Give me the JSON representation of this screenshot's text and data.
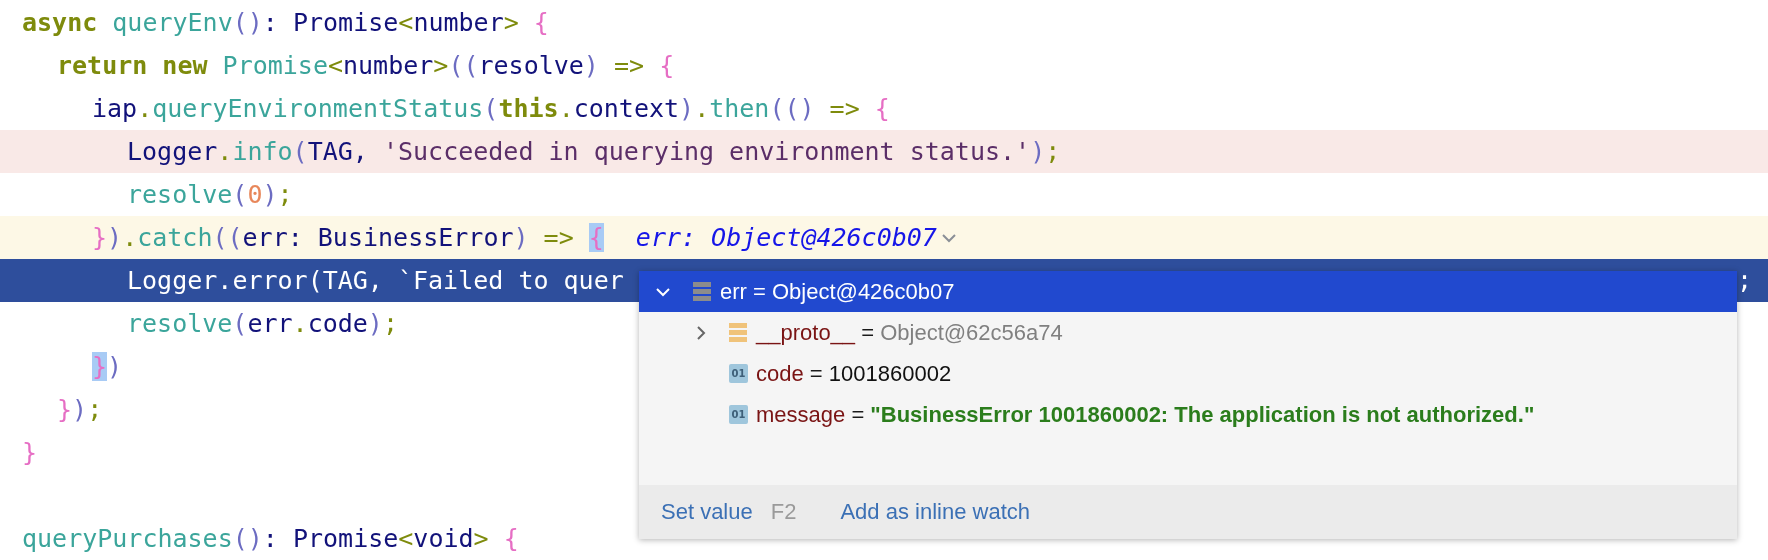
{
  "editor": {
    "lines": [
      {
        "kind": "normal",
        "tokens": [
          {
            "kind": "keyword",
            "text": "async "
          },
          {
            "kind": "fn",
            "text": "queryEnv"
          },
          {
            "kind": "paren",
            "text": "()"
          },
          {
            "kind": "plain",
            "text": ": "
          },
          {
            "kind": "type",
            "text": "Promise"
          },
          {
            "kind": "punct",
            "text": "<"
          },
          {
            "kind": "type",
            "text": "number"
          },
          {
            "kind": "punct",
            "text": ">"
          },
          {
            "kind": "brace",
            "text": " {"
          }
        ],
        "children": [
          {
            "kind": "normal",
            "tokens": [
              {
                "kind": "keyword",
                "text": "return new "
              },
              {
                "kind": "fn",
                "text": "Promise"
              },
              {
                "kind": "punct",
                "text": "<"
              },
              {
                "kind": "type",
                "text": "number"
              },
              {
                "kind": "punct",
                "text": ">"
              },
              {
                "kind": "paren",
                "text": "(("
              },
              {
                "kind": "type",
                "text": "resolve"
              },
              {
                "kind": "paren",
                "text": ")"
              },
              {
                "kind": "punct",
                "text": " => "
              },
              {
                "kind": "brace",
                "text": "{"
              }
            ],
            "children": [
              {
                "kind": "normal",
                "tokens": [
                  {
                    "kind": "type",
                    "text": "iap"
                  },
                  {
                    "kind": "punct",
                    "text": "."
                  },
                  {
                    "kind": "fn",
                    "text": "queryEnvironmentStatus"
                  },
                  {
                    "kind": "paren",
                    "text": "("
                  },
                  {
                    "kind": "keyword",
                    "text": "this"
                  },
                  {
                    "kind": "punct",
                    "text": "."
                  },
                  {
                    "kind": "type",
                    "text": "context"
                  },
                  {
                    "kind": "paren",
                    "text": ")"
                  },
                  {
                    "kind": "punct",
                    "text": "."
                  },
                  {
                    "kind": "fn",
                    "text": "then"
                  },
                  {
                    "kind": "paren",
                    "text": "(()"
                  },
                  {
                    "kind": "punct",
                    "text": " => "
                  },
                  {
                    "kind": "brace",
                    "text": "{"
                  }
                ],
                "children": [
                  {
                    "kind": "breakpoint",
                    "tokens": [
                      {
                        "kind": "type",
                        "text": "Logger"
                      },
                      {
                        "kind": "punct",
                        "text": "."
                      },
                      {
                        "kind": "fn",
                        "text": "info"
                      },
                      {
                        "kind": "paren",
                        "text": "("
                      },
                      {
                        "kind": "type",
                        "text": "TAG, "
                      },
                      {
                        "kind": "string",
                        "text": "'Succeeded in querying environment status.'"
                      },
                      {
                        "kind": "paren",
                        "text": ")"
                      },
                      {
                        "kind": "punct",
                        "text": ";"
                      }
                    ]
                  },
                  {
                    "kind": "normal",
                    "tokens": [
                      {
                        "kind": "fn",
                        "text": "resolve"
                      },
                      {
                        "kind": "paren",
                        "text": "("
                      },
                      {
                        "kind": "number",
                        "text": "0"
                      },
                      {
                        "kind": "paren",
                        "text": ")"
                      },
                      {
                        "kind": "punct",
                        "text": ";"
                      }
                    ]
                  }
                ]
              },
              {
                "kind": "caret",
                "hint": "err: Object@426c0b07",
                "tokens": [
                  {
                    "kind": "brace",
                    "text": "}"
                  },
                  {
                    "kind": "paren",
                    "text": ")"
                  },
                  {
                    "kind": "punct",
                    "text": "."
                  },
                  {
                    "kind": "fn",
                    "text": "catch"
                  },
                  {
                    "kind": "paren",
                    "text": "(("
                  },
                  {
                    "kind": "type",
                    "text": "err: BusinessError"
                  },
                  {
                    "kind": "paren",
                    "text": ")"
                  },
                  {
                    "kind": "punct",
                    "text": " => "
                  },
                  {
                    "kind": "brace",
                    "text": "{",
                    "matched": true
                  }
                ],
                "children": [
                  {
                    "kind": "execution",
                    "tail": ";",
                    "tokens": [
                      {
                        "kind": "type",
                        "text": "Logger"
                      },
                      {
                        "kind": "punct",
                        "text": "."
                      },
                      {
                        "kind": "fn",
                        "text": "error"
                      },
                      {
                        "kind": "paren",
                        "text": "("
                      },
                      {
                        "kind": "type",
                        "text": "TAG, "
                      },
                      {
                        "kind": "string",
                        "text": "`Failed to quer"
                      }
                    ]
                  },
                  {
                    "kind": "normal",
                    "tokens": [
                      {
                        "kind": "fn",
                        "text": "resolve"
                      },
                      {
                        "kind": "paren",
                        "text": "("
                      },
                      {
                        "kind": "type",
                        "text": "err"
                      },
                      {
                        "kind": "punct",
                        "text": "."
                      },
                      {
                        "kind": "type",
                        "text": "code"
                      },
                      {
                        "kind": "paren",
                        "text": ")"
                      },
                      {
                        "kind": "punct",
                        "text": ";"
                      }
                    ]
                  }
                ]
              },
              {
                "kind": "normal",
                "tokens": [
                  {
                    "kind": "brace",
                    "text": "}",
                    "matched": true
                  },
                  {
                    "kind": "paren",
                    "text": ")"
                  }
                ]
              }
            ]
          },
          {
            "kind": "normal",
            "tokens": [
              {
                "kind": "brace",
                "text": "}"
              },
              {
                "kind": "paren",
                "text": ")"
              },
              {
                "kind": "punct",
                "text": ";"
              }
            ]
          }
        ]
      },
      {
        "kind": "normal",
        "tokens": [
          {
            "kind": "brace",
            "text": "}"
          }
        ]
      },
      {
        "kind": "blank"
      },
      {
        "kind": "normal",
        "tokens": [
          {
            "kind": "fn",
            "text": "queryPurchases"
          },
          {
            "kind": "paren",
            "text": "()"
          },
          {
            "kind": "plain",
            "text": ": "
          },
          {
            "kind": "type",
            "text": "Promise"
          },
          {
            "kind": "punct",
            "text": "<"
          },
          {
            "kind": "type",
            "text": "void"
          },
          {
            "kind": "punct",
            "text": ">"
          },
          {
            "kind": "brace",
            "text": " {"
          }
        ]
      }
    ]
  },
  "popup": {
    "tree": {
      "name": "err",
      "operator": "=",
      "value": "Object@426c0b07",
      "kind": "object",
      "expanded": true,
      "selected": true,
      "children": [
        {
          "name": "__proto__",
          "operator": "=",
          "value": "Object@62c56a74",
          "kind": "object",
          "expanded": false,
          "selected": false
        },
        {
          "name": "code",
          "operator": "=",
          "value": "1001860002",
          "kind": "number",
          "badge": "01",
          "selected": false
        },
        {
          "name": "message",
          "operator": "=",
          "value": "\"BusinessError 1001860002: The application is not authorized.\"",
          "kind": "string",
          "badge": "01",
          "selected": false
        }
      ]
    },
    "actions": [
      {
        "label": "Set value",
        "shortcut": "F2"
      },
      {
        "label": "Add as inline watch"
      }
    ]
  }
}
